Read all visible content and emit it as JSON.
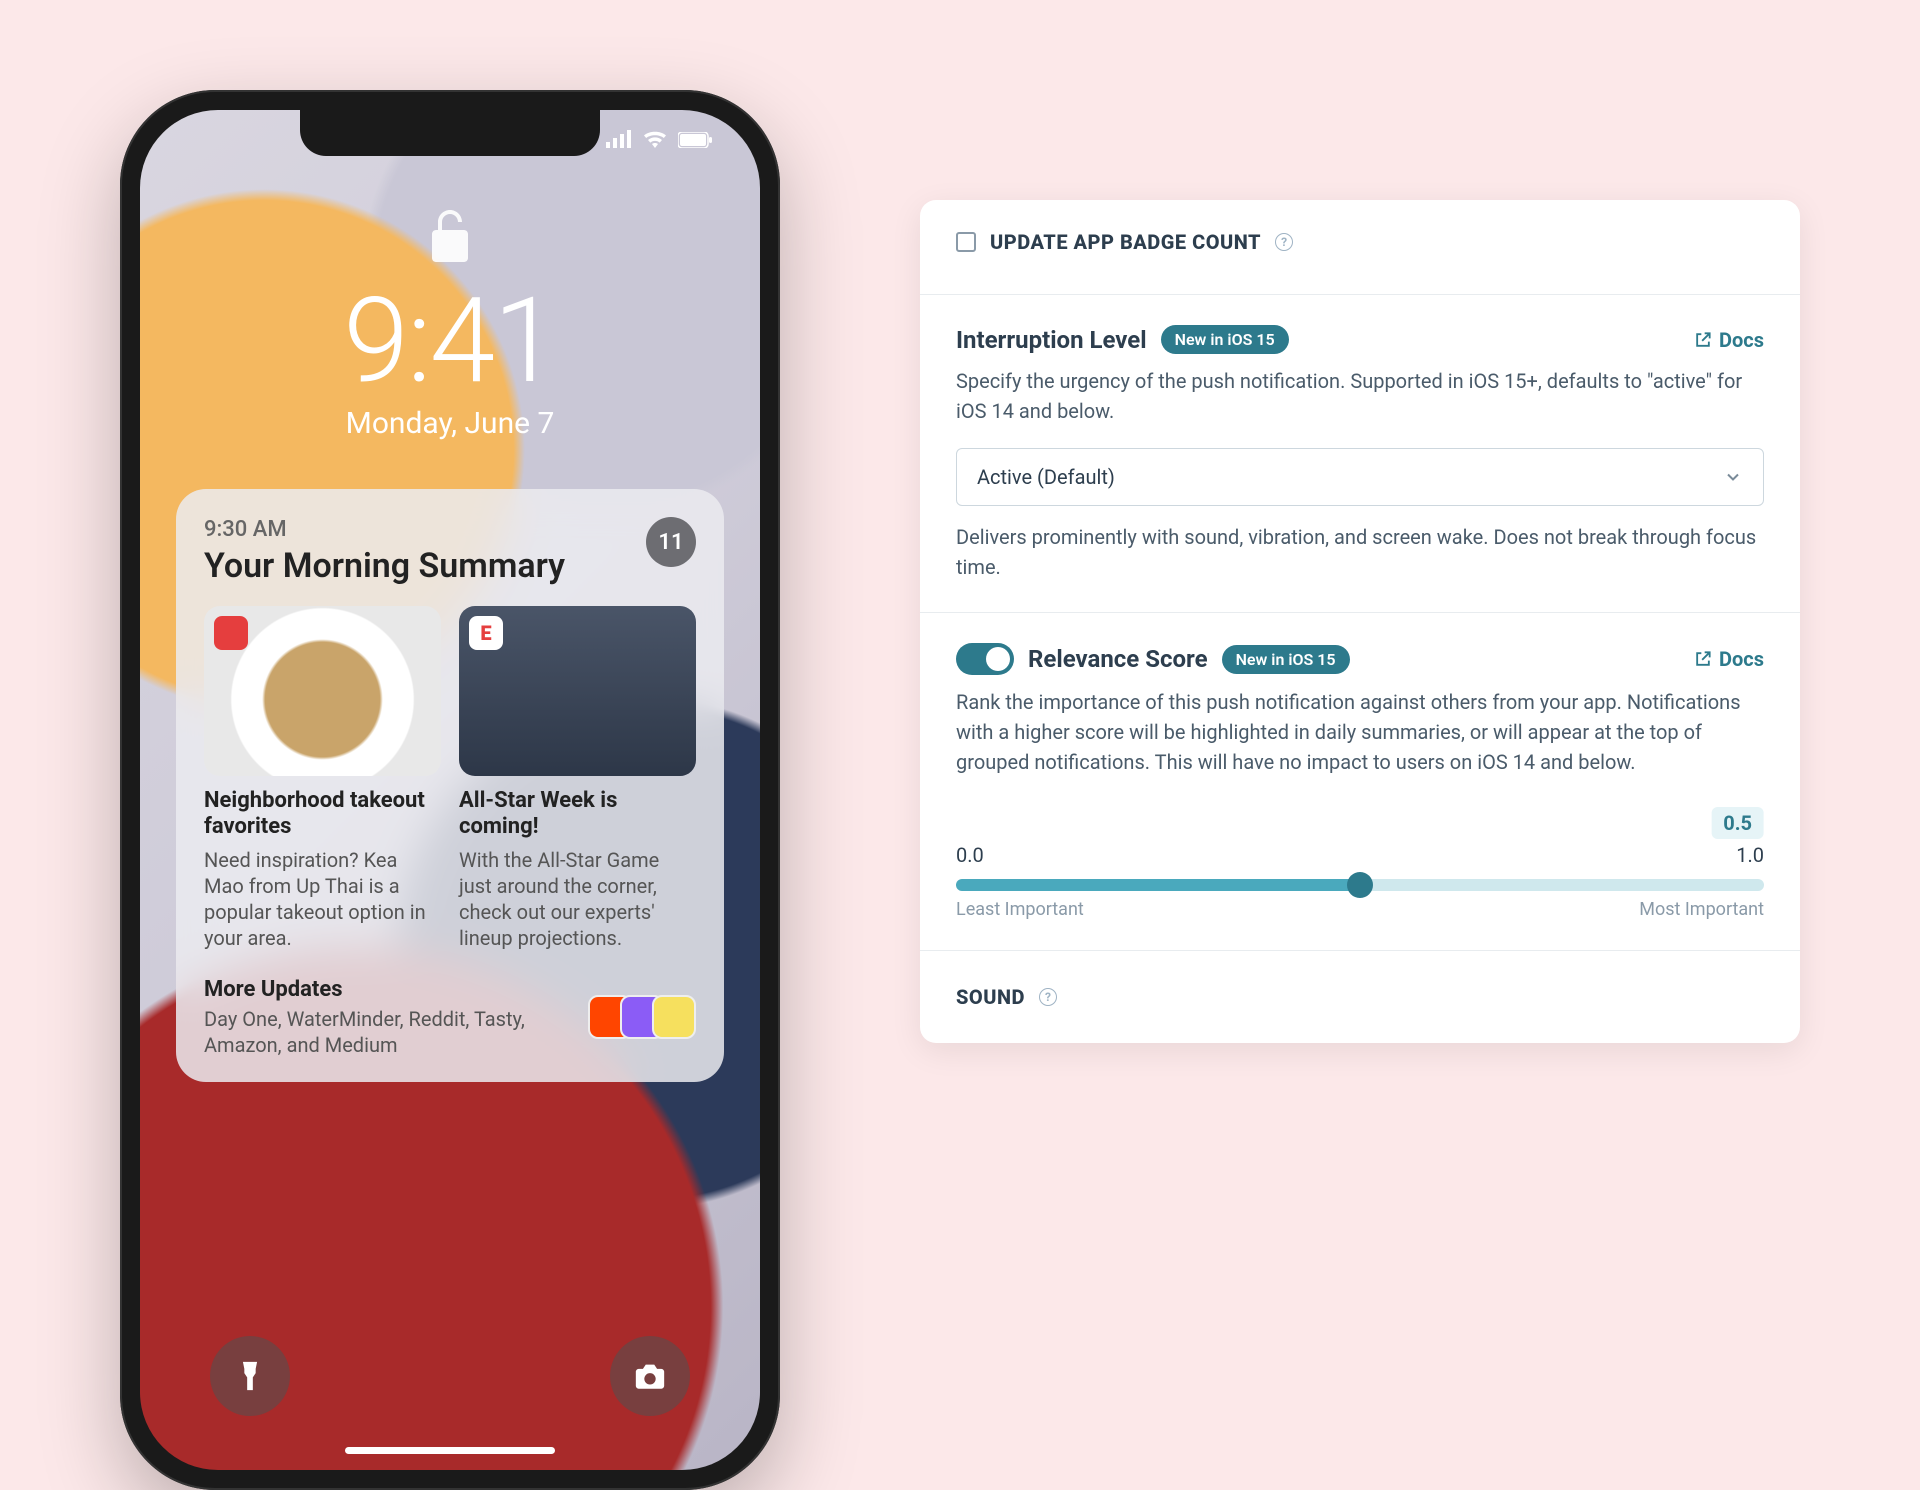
{
  "phone": {
    "time": "9:41",
    "date": "Monday, June 7",
    "summary": {
      "timestamp": "9:30 AM",
      "title": "Your Morning Summary",
      "count": "11",
      "items": [
        {
          "heading": "Neighborhood takeout favorites",
          "body": "Need inspiration? Kea Mao from Up Thai is a popular takeout option in your area."
        },
        {
          "heading": "All-Star Week is coming!",
          "body": "With the All-Star Game just around the corner, check out our experts' lineup projections."
        }
      ],
      "more": {
        "heading": "More Updates",
        "body": "Day One, WaterMinder, Reddit, Tasty, Amazon, and Medium"
      }
    }
  },
  "panel": {
    "badge_count": {
      "label": "UPDATE APP BADGE COUNT"
    },
    "interruption": {
      "title": "Interruption Level",
      "badge": "New in iOS 15",
      "docs": "Docs",
      "desc": "Specify the urgency of the push notification. Supported in iOS 15+, defaults to \"active\" for iOS 14 and below.",
      "selected": "Active (Default)",
      "helper": "Delivers prominently with sound, vibration, and screen wake. Does not break through focus time."
    },
    "relevance": {
      "title": "Relevance Score",
      "badge": "New in iOS 15",
      "docs": "Docs",
      "desc": "Rank the importance of this push notification against others from your app. Notifications with a higher score will be highlighted in daily summaries, or will appear at the top of grouped notifications. This will have no impact to users on iOS 14 and below.",
      "value": "0.5",
      "min": "0.0",
      "max": "1.0",
      "min_label": "Least Important",
      "max_label": "Most Important"
    },
    "sound": {
      "label": "SOUND"
    }
  }
}
